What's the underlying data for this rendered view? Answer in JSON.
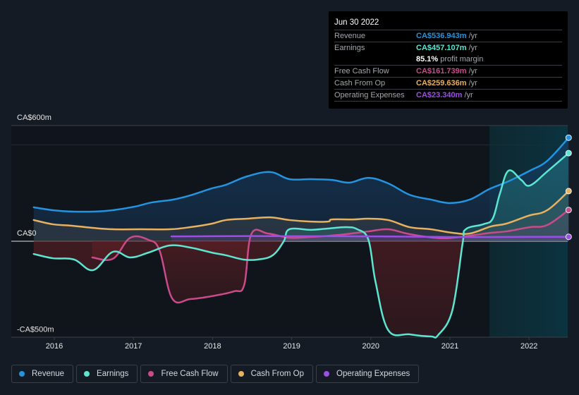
{
  "tooltip": {
    "date": "Jun 30 2022",
    "rows": [
      {
        "label": "Revenue",
        "value": "CA$536.943m",
        "unit": "/yr",
        "color": "#2394df"
      },
      {
        "label": "Earnings",
        "value": "CA$457.107m",
        "unit": "/yr",
        "color": "#5ce6d1"
      },
      {
        "label": "",
        "value": "85.1%",
        "unit": "profit margin",
        "color": "#ffffff"
      },
      {
        "label": "Free Cash Flow",
        "value": "CA$161.739m",
        "unit": "/yr",
        "color": "#c94b8a"
      },
      {
        "label": "Cash From Op",
        "value": "CA$259.636m",
        "unit": "/yr",
        "color": "#e8b15f"
      },
      {
        "label": "Operating Expenses",
        "value": "CA$23.340m",
        "unit": "/yr",
        "color": "#9d4ee6"
      }
    ]
  },
  "legend": [
    {
      "label": "Revenue",
      "color": "#2394df"
    },
    {
      "label": "Earnings",
      "color": "#5ce6d1"
    },
    {
      "label": "Free Cash Flow",
      "color": "#c94b8a"
    },
    {
      "label": "Cash From Op",
      "color": "#e8b15f"
    },
    {
      "label": "Operating Expenses",
      "color": "#9d4ee6"
    }
  ],
  "chart_data": {
    "type": "line",
    "title": "",
    "xlabel": "",
    "ylabel": "",
    "currency_unit": "CA$ millions",
    "x_ticks": [
      "2016",
      "2017",
      "2018",
      "2019",
      "2020",
      "2021",
      "2022"
    ],
    "y_tick_labels": [
      "CA$600m",
      "CA$0",
      "-CA$500m"
    ],
    "y_ticks": [
      600,
      0,
      -500
    ],
    "ylim": [
      -500,
      600
    ],
    "xlim": [
      2015.45,
      2022.5
    ],
    "highlight_from": 2021.5,
    "grid": true,
    "legend_position": "bottom",
    "series": [
      {
        "name": "Revenue",
        "color": "#2394df",
        "x": [
          2015.74,
          2015.98,
          2016.21,
          2016.52,
          2016.74,
          2017.01,
          2017.23,
          2017.5,
          2017.72,
          2017.99,
          2018.17,
          2018.44,
          2018.73,
          2018.97,
          2019.24,
          2019.51,
          2019.73,
          2019.97,
          2020.22,
          2020.49,
          2020.76,
          2021.0,
          2021.25,
          2021.5,
          2021.74,
          2022.01,
          2022.23,
          2022.5
        ],
        "values": [
          176,
          161,
          154,
          154,
          161,
          179,
          201,
          216,
          238,
          274,
          293,
          337,
          359,
          322,
          322,
          318,
          304,
          329,
          300,
          241,
          216,
          198,
          216,
          271,
          311,
          366,
          417,
          537
        ]
      },
      {
        "name": "Earnings",
        "color": "#5ce6d1",
        "x": [
          2015.74,
          2015.98,
          2016.25,
          2016.49,
          2016.74,
          2016.96,
          2017.19,
          2017.46,
          2017.72,
          2017.99,
          2018.17,
          2018.39,
          2018.57,
          2018.76,
          2018.9,
          2018.97,
          2019.24,
          2019.46,
          2019.69,
          2019.83,
          2019.97,
          2020.06,
          2020.22,
          2020.49,
          2020.76,
          2020.85,
          2021.03,
          2021.16,
          2021.2,
          2021.42,
          2021.54,
          2021.63,
          2021.74,
          2021.9,
          2022.01,
          2022.23,
          2022.5
        ],
        "values": [
          -66,
          -88,
          -95,
          -150,
          -55,
          -84,
          -59,
          -22,
          -33,
          -59,
          -73,
          -95,
          -95,
          -73,
          0,
          62,
          59,
          66,
          73,
          62,
          7,
          -212,
          -461,
          -483,
          -494,
          -487,
          -359,
          -11,
          62,
          88,
          117,
          245,
          366,
          318,
          289,
          362,
          457
        ]
      },
      {
        "name": "Free Cash Flow",
        "color": "#c94b8a",
        "x": [
          2016.48,
          2016.74,
          2016.96,
          2017.19,
          2017.33,
          2017.49,
          2017.72,
          2017.99,
          2018.27,
          2018.4,
          2018.49,
          2018.7,
          2018.97,
          2019.24,
          2019.6,
          2019.97,
          2020.22,
          2020.49,
          2020.9,
          2021.25,
          2021.52,
          2021.71,
          2022.01,
          2022.23,
          2022.5
        ],
        "values": [
          -84,
          -91,
          18,
          7,
          -48,
          -297,
          -300,
          -285,
          -260,
          -227,
          37,
          40,
          18,
          22,
          33,
          51,
          62,
          37,
          15,
          29,
          44,
          51,
          73,
          84,
          162
        ]
      },
      {
        "name": "Cash From Op",
        "color": "#e8b15f",
        "x": [
          2015.74,
          2015.98,
          2016.21,
          2016.47,
          2016.74,
          2017.1,
          2017.46,
          2017.72,
          2017.99,
          2018.17,
          2018.44,
          2018.73,
          2018.97,
          2019.24,
          2019.46,
          2019.51,
          2019.78,
          2019.97,
          2020.22,
          2020.49,
          2020.76,
          2021.03,
          2021.25,
          2021.52,
          2021.71,
          2021.99,
          2022.23,
          2022.5
        ],
        "values": [
          110,
          88,
          81,
          70,
          62,
          62,
          62,
          73,
          91,
          110,
          117,
          124,
          110,
          102,
          102,
          113,
          113,
          117,
          110,
          73,
          62,
          44,
          40,
          77,
          91,
          132,
          161,
          260
        ]
      },
      {
        "name": "Operating Expenses",
        "color": "#9d4ee6",
        "x": [
          2017.48,
          2018.0,
          2018.5,
          2019.0,
          2019.5,
          2020.0,
          2020.5,
          2021.0,
          2021.5,
          2022.0,
          2022.5
        ],
        "values": [
          25,
          26,
          27,
          26,
          26,
          25,
          24,
          22,
          22,
          23,
          23
        ]
      }
    ]
  }
}
